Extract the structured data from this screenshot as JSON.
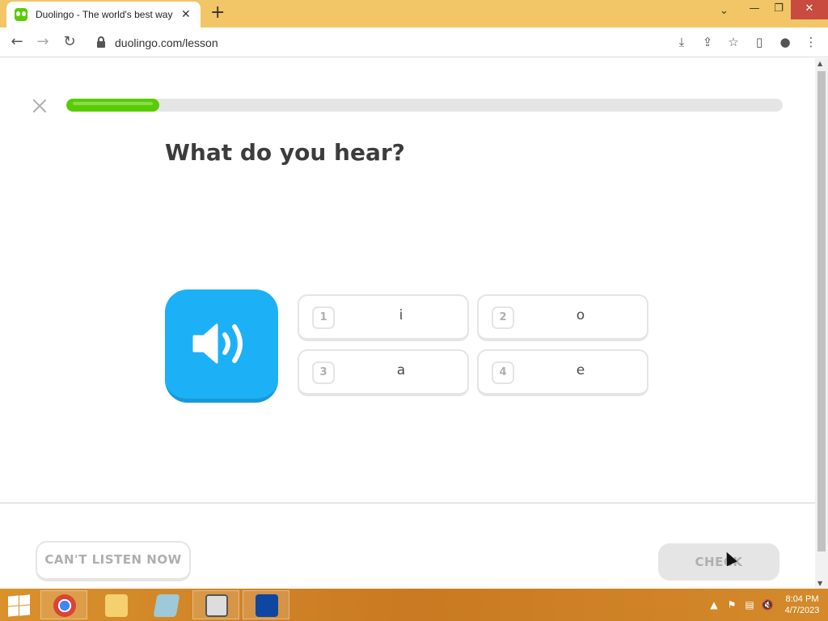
{
  "browser": {
    "tab_title": "Duolingo - The world's best way",
    "tab_close": "✕",
    "new_tab": "+",
    "url": "duolingo.com/lesson",
    "window_controls": {
      "minimize": "—",
      "restore": "❐",
      "close": "✕"
    }
  },
  "lesson": {
    "progress": 0.13,
    "prompt": "What do you hear?",
    "choices": [
      {
        "num": "1",
        "text": "i"
      },
      {
        "num": "2",
        "text": "o"
      },
      {
        "num": "3",
        "text": "a"
      },
      {
        "num": "4",
        "text": "e"
      }
    ],
    "cant_listen_label": "CAN'T LISTEN NOW",
    "check_label": "CHECK"
  },
  "colors": {
    "progress_fill": "#58cc02",
    "speaker_button": "#1cb0f6",
    "taskbar": "#d9912c",
    "tabstrip": "#f2c566"
  },
  "taskbar": {
    "apps": [
      "chrome-icon",
      "file-explorer-icon",
      "notepad-icon",
      "media-icon",
      "onedrive-icon"
    ],
    "clock_time": "8:04 PM",
    "clock_date": "4/7/2023"
  }
}
